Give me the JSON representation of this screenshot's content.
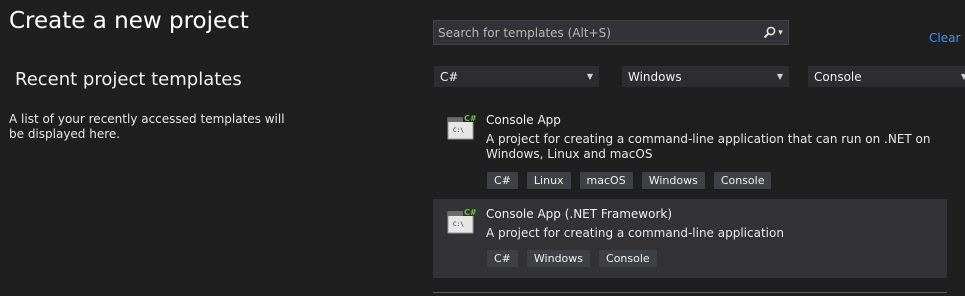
{
  "page": {
    "title": "Create a new project"
  },
  "recent": {
    "heading": "Recent project templates",
    "description": "A list of your recently accessed templates will be displayed here."
  },
  "search": {
    "placeholder": "Search for templates (Alt+S)",
    "value": "",
    "icon": "search-icon"
  },
  "clear_all_label": "Clear a",
  "filters": {
    "language": "C#",
    "platform": "Windows",
    "project_type": "Console"
  },
  "templates": [
    {
      "name": "Console App",
      "description": "A project for creating a command-line application that can run on .NET on Windows, Linux and macOS",
      "icon": "console-app-icon",
      "icon_badge": "C#",
      "icon_text": "C:\\",
      "tags": [
        "C#",
        "Linux",
        "macOS",
        "Windows",
        "Console"
      ],
      "selected": false
    },
    {
      "name": "Console App (.NET Framework)",
      "description": "A project for creating a command-line application",
      "icon": "console-app-icon",
      "icon_badge": "C#",
      "icon_text": "C:\\",
      "tags": [
        "C#",
        "Windows",
        "Console"
      ],
      "selected": true
    }
  ],
  "colors": {
    "background": "#1f1f1f",
    "selected_row": "#333337",
    "link": "#3794ff",
    "csharp_badge": "#68c23a"
  }
}
